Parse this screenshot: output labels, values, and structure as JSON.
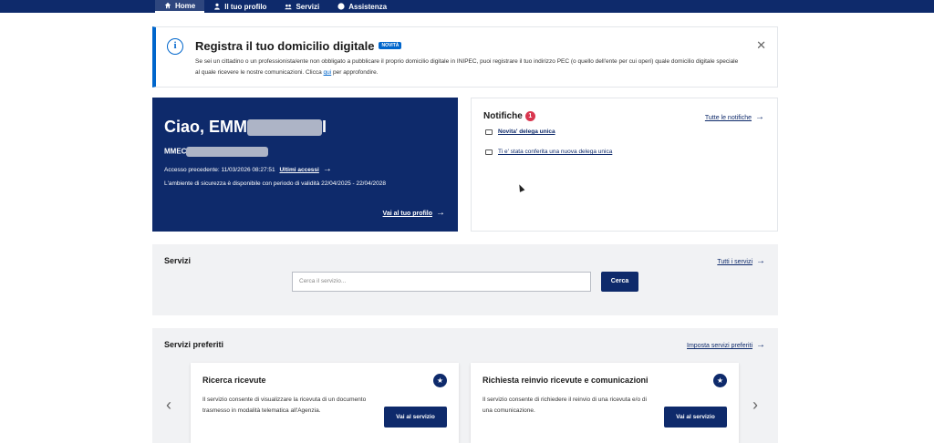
{
  "nav": {
    "items": [
      {
        "label": "Home",
        "icon": "home-icon",
        "active": true
      },
      {
        "label": "Il tuo profilo",
        "icon": "user-icon",
        "active": false
      },
      {
        "label": "Servizi",
        "icon": "services-icon",
        "active": false
      },
      {
        "label": "Assistenza",
        "icon": "info-icon",
        "active": false
      }
    ]
  },
  "banner": {
    "title": "Registra il tuo domicilio digitale",
    "badge": "NOVITÀ",
    "text_before": "Se sei un cittadino o un professionista/ente non obbligato a pubblicare il proprio domicilio digitale in INIPEC, puoi registrare il tuo indirizzo PEC (o quello dell'ente per cui operi) quale domicilio digitale speciale al quale ricevere le nostre comunicazioni. Clicca ",
    "link": "qui",
    "text_after": " per approfondire.",
    "close": "✕"
  },
  "welcome": {
    "greeting_prefix": "Ciao, EMM",
    "greeting_suffix": "I",
    "code_prefix": "MMEC",
    "last_access_label": "Accesso precedente: 11/03/2026 08:27:51",
    "last_access_link": "Ultimi accessi",
    "security_text": "L'ambiente di sicurezza è disponibile con periodo di validità 22/04/2025 - 22/04/2028",
    "profile_link": "Vai al tuo profilo"
  },
  "notifications": {
    "title": "Notifiche",
    "count": "1",
    "all_link": "Tutte le notifiche",
    "items": [
      {
        "label": "Novita' delega unica",
        "unread": true
      },
      {
        "label": "Ti e' stata conferita una nuova delega unica",
        "unread": false
      }
    ]
  },
  "services": {
    "title": "Servizi",
    "all_link": "Tutti i servizi",
    "search_placeholder": "Cerca il servizio...",
    "search_button": "Cerca"
  },
  "favorites": {
    "title": "Servizi preferiti",
    "settings_link": "Imposta servizi preferiti",
    "cards": [
      {
        "title": "Ricerca ricevute",
        "description": "Il servizio consente di visualizzare la ricevuta di un documento trasmesso in modalità telematica all'Agenzia.",
        "button": "Vai al servizio"
      },
      {
        "title": "Richiesta reinvio ricevute e comunicazioni",
        "description": "Il servizio consente di richiedere il reinvio di una ricevuta e/o di una comunicazione.",
        "button": "Vai al servizio"
      }
    ]
  },
  "colors": {
    "primary": "#0e2a6b",
    "accent": "#0066cc",
    "badge_red": "#d9364f",
    "panel_grey": "#f1f2f4"
  }
}
